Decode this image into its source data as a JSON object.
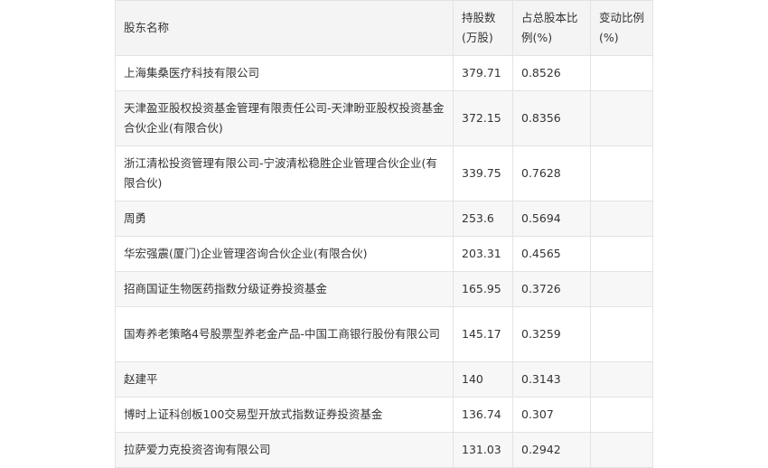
{
  "table": {
    "headers": {
      "name": "股东名称",
      "shares": "持股数(万股)",
      "ratio": "占总股本比例(%)",
      "change": "变动比例(%)"
    },
    "rows": [
      {
        "name": "上海集桑医疗科技有限公司",
        "shares": "379.71",
        "ratio": "0.8526",
        "change": ""
      },
      {
        "name": "天津盈亚股权投资基金管理有限责任公司-天津盼亚股权投资基金合伙企业(有限合伙)",
        "shares": "372.15",
        "ratio": "0.8356",
        "change": ""
      },
      {
        "name": "浙江清松投资管理有限公司-宁波清松稳胜企业管理合伙企业(有限合伙)",
        "shares": "339.75",
        "ratio": "0.7628",
        "change": ""
      },
      {
        "name": "周勇",
        "shares": "253.6",
        "ratio": "0.5694",
        "change": ""
      },
      {
        "name": "华宏强震(厦门)企业管理咨询合伙企业(有限合伙)",
        "shares": "203.31",
        "ratio": "0.4565",
        "change": ""
      },
      {
        "name": "招商国证生物医药指数分级证券投资基金",
        "shares": "165.95",
        "ratio": "0.3726",
        "change": ""
      },
      {
        "name": "国寿养老策略4号股票型养老金产品-中国工商银行股份有限公司",
        "shares": "145.17",
        "ratio": "0.3259",
        "change": ""
      },
      {
        "name": "赵建平",
        "shares": "140",
        "ratio": "0.3143",
        "change": ""
      },
      {
        "name": "博时上证科创板100交易型开放式指数证券投资基金",
        "shares": "136.74",
        "ratio": "0.307",
        "change": ""
      },
      {
        "name": "拉萨爱力克投资咨询有限公司",
        "shares": "131.03",
        "ratio": "0.2942",
        "change": ""
      }
    ]
  }
}
